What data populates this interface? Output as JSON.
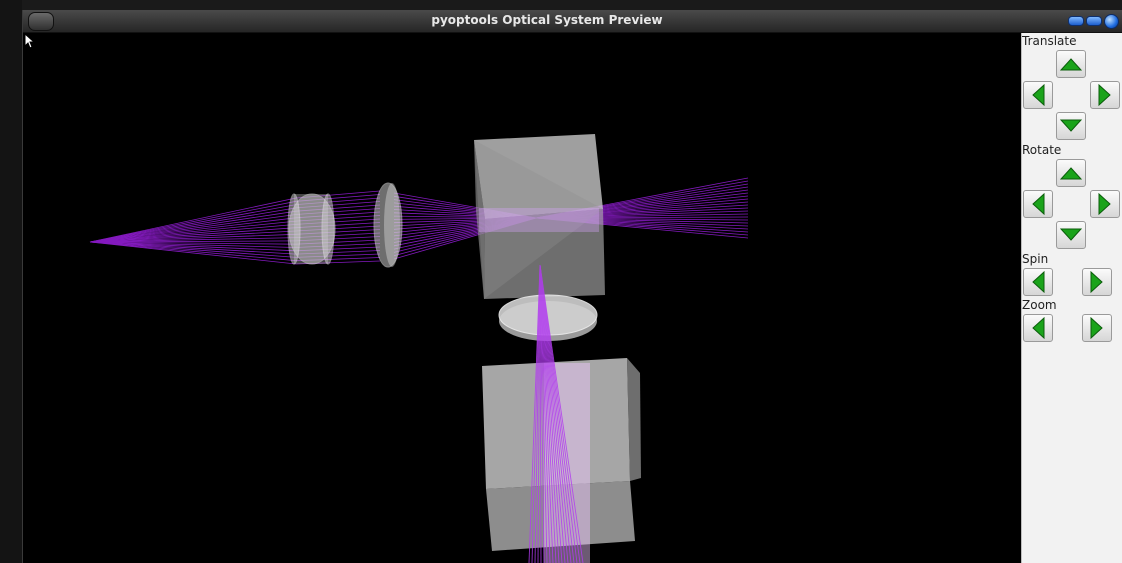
{
  "window": {
    "title": "pyoptools Optical System Preview"
  },
  "controls": {
    "translate_label": "Translate",
    "rotate_label": "Rotate",
    "spin_label": "Spin",
    "zoom_label": "Zoom"
  },
  "icons": {
    "arrow_up": "up-arrow-icon",
    "arrow_down": "down-arrow-icon",
    "arrow_left": "left-arrow-icon",
    "arrow_right": "right-arrow-icon"
  },
  "colors": {
    "ray_color": "#9b1fe0",
    "arrow_green": "#1aa31a",
    "canvas_background": "#000000",
    "panel_background": "#f2f2f2"
  }
}
